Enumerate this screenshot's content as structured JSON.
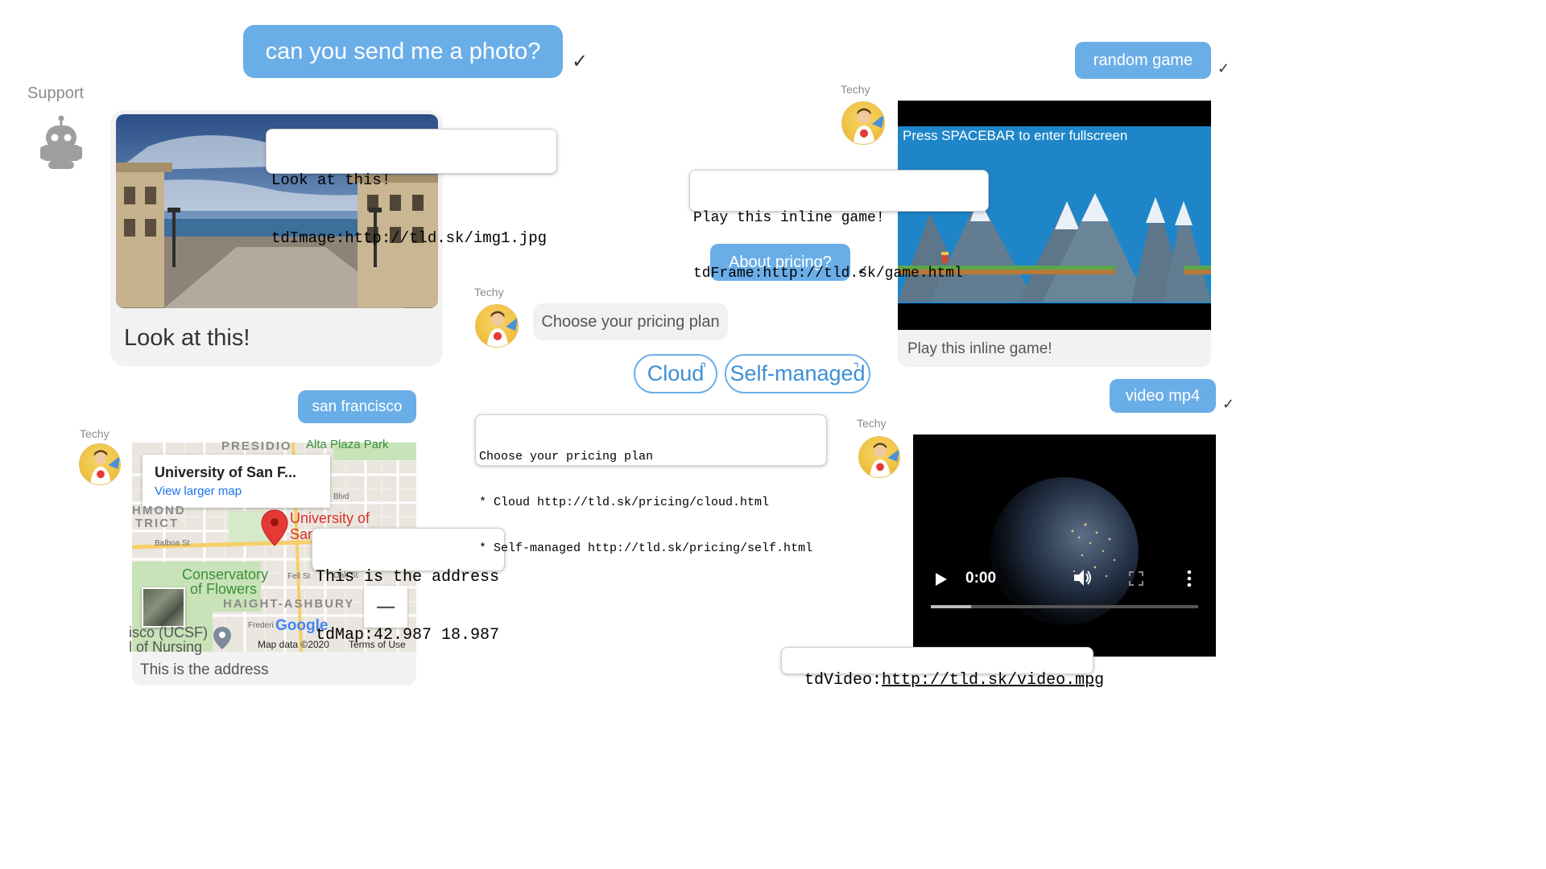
{
  "chat1": {
    "user_message": "can you send me a photo?",
    "check": "✓",
    "agent_name": "Support",
    "card_caption": "Look at this!",
    "callout_line1": "Look at this!",
    "callout_line2": "tdImage:http://tld.sk/img1.jpg"
  },
  "chat2": {
    "user_message": "san francisco",
    "agent_name": "Techy",
    "map": {
      "place_title": "University of San F...",
      "larger_map_link": "View larger map",
      "pin_label_1": "University of",
      "pin_label_2": "San",
      "label_presidio": "PRESIDIO",
      "label_alta_plaza": "Alta Plaza Park",
      "label_richmond": "HMOND",
      "label_district": "TRICT",
      "label_balboa": "Balboa St",
      "label_blvd": "Blvd",
      "label_conservatory": "Conservatory",
      "label_of_flowers": "of Flowers",
      "label_fell": "Fell St",
      "label_oak": "Oak St",
      "label_haight": "HAIGHT-ASHBURY",
      "label_ucsf": "isco (UCSF)",
      "label_nursing": "l of Nursing",
      "label_frederick": "Frederi",
      "google_logo": "Google",
      "map_data": "Map data ©2020",
      "terms": "Terms of Use",
      "zoom_out": "—"
    },
    "card_caption": "This is the address",
    "callout_line1": "This is the address",
    "callout_line2": "tdMap:42.987 18.987"
  },
  "chat3": {
    "user_message": "About pricing?",
    "check": "✓",
    "agent_name": "Techy",
    "agent_message": "Choose your pricing plan",
    "choice_cloud": "Cloud",
    "choice_self": "Self-managed",
    "ext_icon": "⌝",
    "callout_line1": "Choose your pricing plan",
    "callout_line2": "* Cloud http://tld.sk/pricing/cloud.html",
    "callout_line3": "* Self-managed http://tld.sk/pricing/self.html"
  },
  "chat4": {
    "user_message": "random game",
    "check": "✓",
    "agent_name": "Techy",
    "game_banner": "Press SPACEBAR to enter fullscreen",
    "card_caption": "Play this inline game!",
    "callout_line1": "Play this inline game!",
    "callout_line2": "tdFrame:http://tld.sk/game.html"
  },
  "chat5": {
    "user_message": "video mp4",
    "check": "✓",
    "agent_name": "Techy",
    "video_time": "0:00",
    "video_progress": 0.15,
    "callout_prefix": "tdVideo:",
    "callout_link": "http://tld.sk/video.mpg"
  },
  "colors": {
    "user_bubble": "#6aaee8",
    "link": "#3d8fd6",
    "map_pin": "#e53935",
    "game_sky": "#1e86c8"
  }
}
